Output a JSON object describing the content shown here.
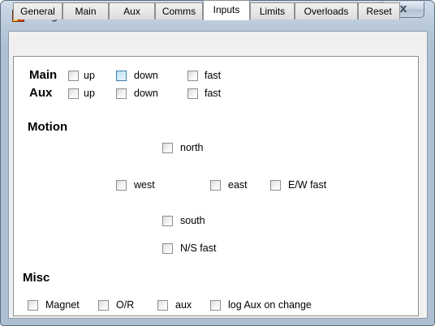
{
  "window": {
    "title": "LiftlogXL",
    "close_glyph": "x"
  },
  "tabs": [
    {
      "label": "General"
    },
    {
      "label": "Main"
    },
    {
      "label": "Aux"
    },
    {
      "label": "Comms"
    },
    {
      "label": "Inputs"
    },
    {
      "label": "Limits"
    },
    {
      "label": "Overloads"
    },
    {
      "label": "Reset"
    }
  ],
  "active_tab": "Inputs",
  "inputs": {
    "main": {
      "label": "Main",
      "up": "up",
      "down": "down",
      "fast": "fast"
    },
    "aux": {
      "label": "Aux",
      "up": "up",
      "down": "down",
      "fast": "fast"
    },
    "motion": {
      "label": "Motion",
      "north": "north",
      "west": "west",
      "east": "east",
      "ew_fast": "E/W fast",
      "south": "south",
      "ns_fast": "N/S fast"
    },
    "misc": {
      "label": "Misc",
      "magnet": "Magnet",
      "or": "O/R",
      "aux": "aux",
      "log_aux": "log Aux on change"
    }
  },
  "colors": {
    "hover_checkbox": "#3c7fb1",
    "window_chrome": "#aebfd1"
  }
}
